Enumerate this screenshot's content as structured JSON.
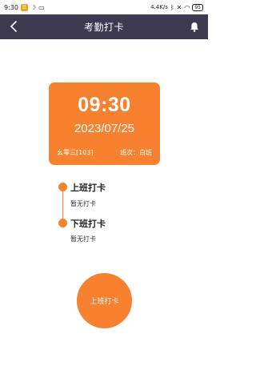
{
  "status_bar": {
    "time": "9:30",
    "app_icon_glyph": "☰",
    "moon_glyph": "☽",
    "screen_glyph": "▭",
    "network_speed": "4.4K/s",
    "bluetooth_glyph": "ᛒ",
    "sim_glyph": "✕",
    "wifi_glyph": "◠",
    "battery": "95"
  },
  "nav": {
    "back_icon": "chevron-left-icon",
    "title": "考勤打卡",
    "bell_icon": "bell-icon"
  },
  "card": {
    "time": "09:30",
    "date": "2023/07/25",
    "user": "幺零三[103]",
    "shift": "班次：白班"
  },
  "timeline": {
    "items": [
      {
        "title": "上班打卡",
        "status": "暂无打卡"
      },
      {
        "title": "下班打卡",
        "status": "暂无打卡"
      }
    ]
  },
  "punch_button": {
    "label": "上班打卡"
  },
  "colors": {
    "accent": "#f7812f",
    "navbar": "#3d3950"
  }
}
